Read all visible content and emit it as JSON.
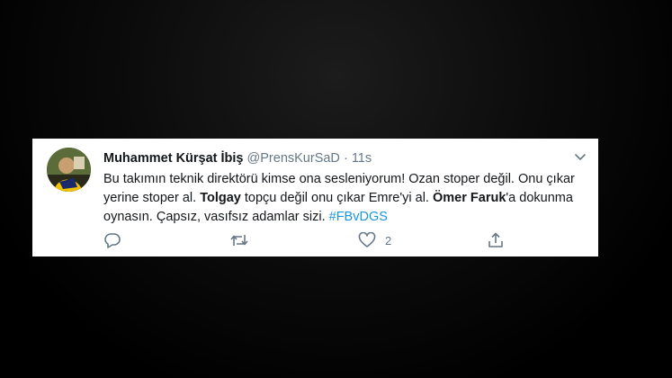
{
  "tweet": {
    "author": {
      "name": "Muhammet Kürşat İbiş",
      "handle": "@PrensKurSaD",
      "separator": "·",
      "time": "11s"
    },
    "body": {
      "t1": "Bu takımın teknik direktörü kimse ona sesleniyorum! Ozan stoper değil. Onu çıkar yerine stoper al. ",
      "b1": "Tolgay",
      "t2": " topçu değil onu çıkar Emre'yi al. ",
      "b2": "Ömer Faruk",
      "t3": "'a dokunma oynasın. Çapsız, vasıfsız adamlar sizi. ",
      "hashtag": "#FBvDGS"
    },
    "actions": {
      "reply_icon": "reply-icon",
      "retweet_icon": "retweet-icon",
      "like_icon": "heart-icon",
      "like_count": "2",
      "share_icon": "share-icon"
    },
    "colors": {
      "text": "#14171a",
      "secondary": "#657786",
      "link": "#1b95e0"
    }
  }
}
